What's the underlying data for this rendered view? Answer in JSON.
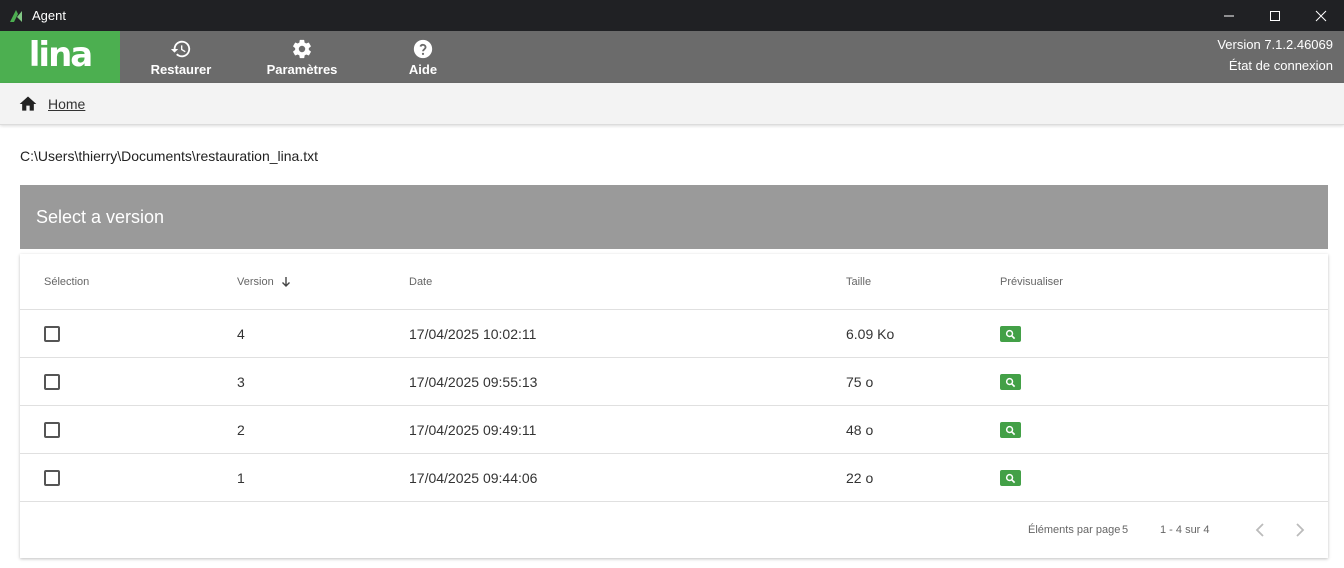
{
  "window": {
    "title": "Agent"
  },
  "brand": {
    "logo_text": "lina",
    "accent": "#4caf50"
  },
  "nav": {
    "items": [
      {
        "label": "Restaurer",
        "icon": "history-icon"
      },
      {
        "label": "Paramètres",
        "icon": "gear-icon"
      },
      {
        "label": "Aide",
        "icon": "help-icon"
      }
    ],
    "version": "Version 7.1.2.46069",
    "connection_status": "État de connexion"
  },
  "breadcrumb": {
    "home_label": "Home"
  },
  "file_path": "C:\\Users\\thierry\\Documents\\restauration_lina.txt",
  "panel": {
    "title": "Select a version"
  },
  "table": {
    "columns": {
      "selection": "Sélection",
      "version": "Version",
      "date": "Date",
      "size": "Taille",
      "preview": "Prévisualiser"
    },
    "rows": [
      {
        "version": "4",
        "date": "17/04/2025 10:02:11",
        "size": "6.09 Ko"
      },
      {
        "version": "3",
        "date": "17/04/2025 09:55:13",
        "size": "75 o"
      },
      {
        "version": "2",
        "date": "17/04/2025 09:49:11",
        "size": "48 o"
      },
      {
        "version": "1",
        "date": "17/04/2025 09:44:06",
        "size": "22 o"
      }
    ]
  },
  "paginator": {
    "items_per_page_label": "Éléments par page",
    "page_size": "5",
    "range_label": "1 - 4 sur 4"
  }
}
